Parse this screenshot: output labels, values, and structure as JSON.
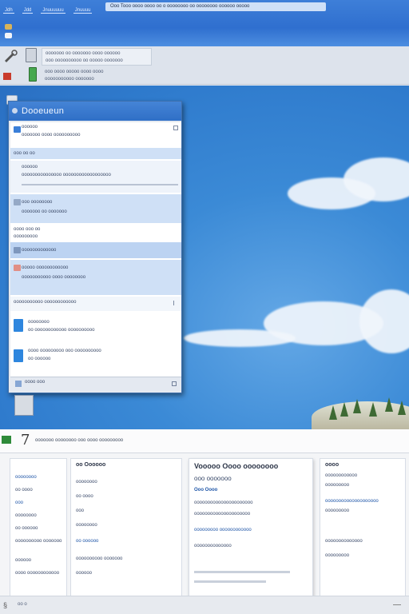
{
  "browser": {
    "tabs": [
      "Jdh",
      "Jdd",
      "Jnuuuuuu",
      "Jnuuuu"
    ],
    "address": "Ooo   Tooo oooo oooo oo o oooooooo oo oooooooo oooooo ooooo"
  },
  "toolbar": {
    "row1": [
      "ooooooo oo ooooooo oooo oooooo",
      "ooo oooooooooo oo ooooo ooooooo"
    ],
    "row2": [
      "ooo oooo ooooo oooo oooo",
      "ooooooooooo ooooooo"
    ]
  },
  "dialog": {
    "title": "Dooeueun",
    "rows": [
      {
        "label": "oooooo",
        "sub": "ooooooo oooo oooooooooo",
        "selected": false
      },
      {
        "label": "ooo oo oo",
        "sub": "",
        "selected": true
      },
      {
        "label": "oooooo",
        "sub": "ooooooooooooooo oooooooooooooooooo",
        "selected": true
      },
      {
        "label": "ooo oooooooo",
        "sub": "ooooooo oo ooooooo",
        "selected": true
      },
      {
        "label": "oooo ooo oo",
        "sub": "ooooooooo",
        "selected": false
      },
      {
        "label": "ooooooooooooo",
        "sub": "",
        "selected": true
      },
      {
        "label": "ooooo oooooooooooo",
        "sub": "ooooooooooo oooo oooooooo",
        "selected": true
      },
      {
        "label": "ooooooooooo oooooooooooo",
        "sub": "",
        "selected": false
      },
      {
        "label": "oooooooo",
        "sub": "oo oooooooooooo oooooooooo",
        "selected": false
      },
      {
        "label": "oooo ooooooooo ooo oooooooooo",
        "sub": "oo oooooo",
        "selected": false
      }
    ],
    "footer": "oooo ooo"
  },
  "bottom": {
    "header": "ooooooo oooooooo ooo oooo ooooooooo",
    "columns": [
      {
        "title": "oo Oooooo",
        "items": [
          "oooooooo",
          "oo oooo",
          "ooo",
          "oooooooo",
          "oo oooooo",
          "oooooooooo ooooooo",
          "oooooo",
          "oooo oooooooooooo"
        ]
      },
      {
        "title": "Vooooo Oooo oooooooo",
        "items": [
          "ooo ooooooo",
          "Ooo Oooo",
          "oooooooooooooooooooooo",
          "ooooooooooooooooooooo",
          "ooooooooo oooooooooooo",
          "oooooooooooooo"
        ]
      },
      {
        "title": "oooo",
        "items": [
          "oooooooooooo",
          "ooooooooo",
          "oooooooooooooooooooo",
          "ooooooooo",
          "oooooooooooooo",
          "ooooooooo"
        ]
      }
    ],
    "status": "oo o"
  }
}
